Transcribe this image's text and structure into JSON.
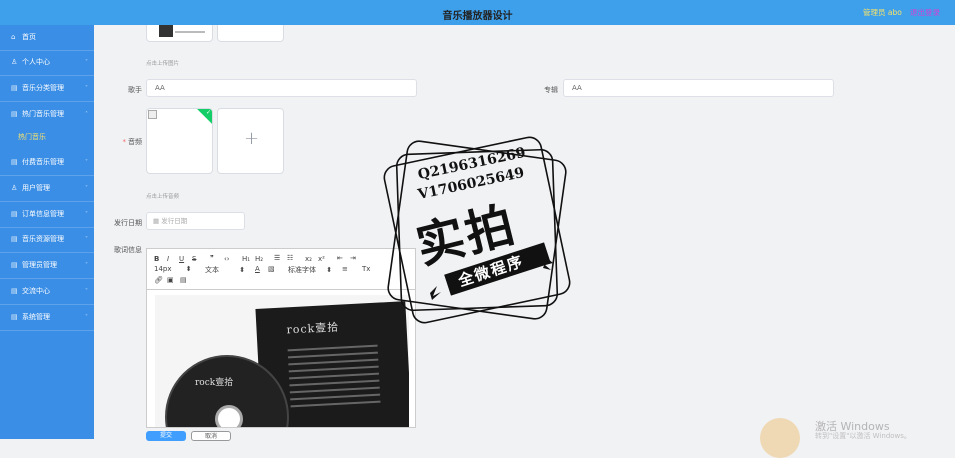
{
  "header": {
    "title": "音乐播放器设计",
    "admin_label": "管理员 abo",
    "logout_label": "退出登录"
  },
  "sidebar": {
    "items": [
      {
        "label": "首页",
        "icon": "home-icon"
      },
      {
        "label": "个人中心",
        "icon": "user-icon"
      },
      {
        "label": "音乐分类管理",
        "icon": "category-icon"
      },
      {
        "label": "热门音乐管理",
        "icon": "music-icon"
      },
      {
        "label": "付费音乐管理",
        "icon": "pay-icon"
      },
      {
        "label": "用户管理",
        "icon": "users-icon"
      },
      {
        "label": "订单信息管理",
        "icon": "order-icon"
      },
      {
        "label": "音乐资源管理",
        "icon": "resource-icon"
      },
      {
        "label": "管理员管理",
        "icon": "admin-icon"
      },
      {
        "label": "交流中心",
        "icon": "chat-icon"
      },
      {
        "label": "系统管理",
        "icon": "system-icon"
      }
    ],
    "subitem": "热门音乐"
  },
  "form": {
    "cover_hint": "点击上传图片",
    "singer_label": "歌手",
    "singer_value": "AA",
    "album_label": "专辑",
    "album_value": "AA",
    "audio_label": "音频",
    "audio_hint": "点击上传音频",
    "release_label": "发行日期",
    "release_placeholder": "发行日期",
    "lyrics_label": "歌词信息"
  },
  "editor": {
    "font_size": "14px",
    "text_style": "文本",
    "font_family": "标准字体",
    "album_title": "rock壹拾",
    "disc_title": "rock壹拾"
  },
  "buttons": {
    "submit": "提交",
    "cancel": "取消"
  },
  "watermark": {
    "line1": "Q2196316269",
    "line2": "V1706025649",
    "big": "实拍",
    "banner": "全微程序"
  },
  "windows": {
    "activate": "激活 Windows",
    "sub": "转到\"设置\"以激活 Windows。"
  }
}
